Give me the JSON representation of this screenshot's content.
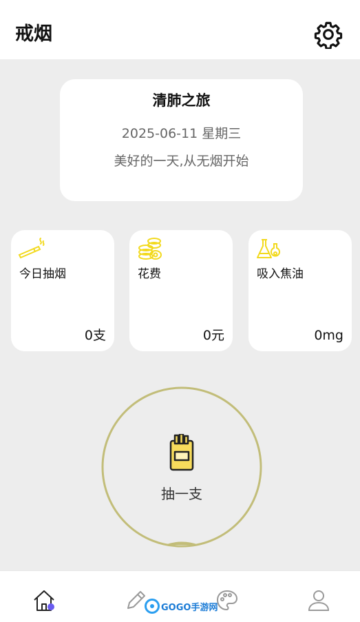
{
  "header": {
    "title": "戒烟",
    "settings_icon": "gear-icon"
  },
  "hero": {
    "title": "清肺之旅",
    "date": "2025-06-11 星期三",
    "motto": "美好的一天,从无烟开始"
  },
  "stats": [
    {
      "icon": "cigarette-icon",
      "label": "今日抽烟",
      "value": "0支"
    },
    {
      "icon": "coins-icon",
      "label": "花费",
      "value": "0元"
    },
    {
      "icon": "flask-icon",
      "label": "吸入焦油",
      "value": "0mg"
    }
  ],
  "smoke_button": {
    "label": "抽一支",
    "icon": "cigarette-pack-icon"
  },
  "tabbar": {
    "tabs": [
      {
        "name": "home",
        "icon": "home-icon"
      },
      {
        "name": "record",
        "icon": "pencil-icon"
      },
      {
        "name": "theme",
        "icon": "palette-icon"
      },
      {
        "name": "profile",
        "icon": "user-icon"
      }
    ]
  },
  "colors": {
    "background": "#ededed",
    "card": "#ffffff",
    "accent_yellow": "#f2d91c",
    "ring": "#c2bd79",
    "tab_active_dot": "#6a5cf0"
  },
  "watermark": {
    "text": "GOGO手游网"
  }
}
